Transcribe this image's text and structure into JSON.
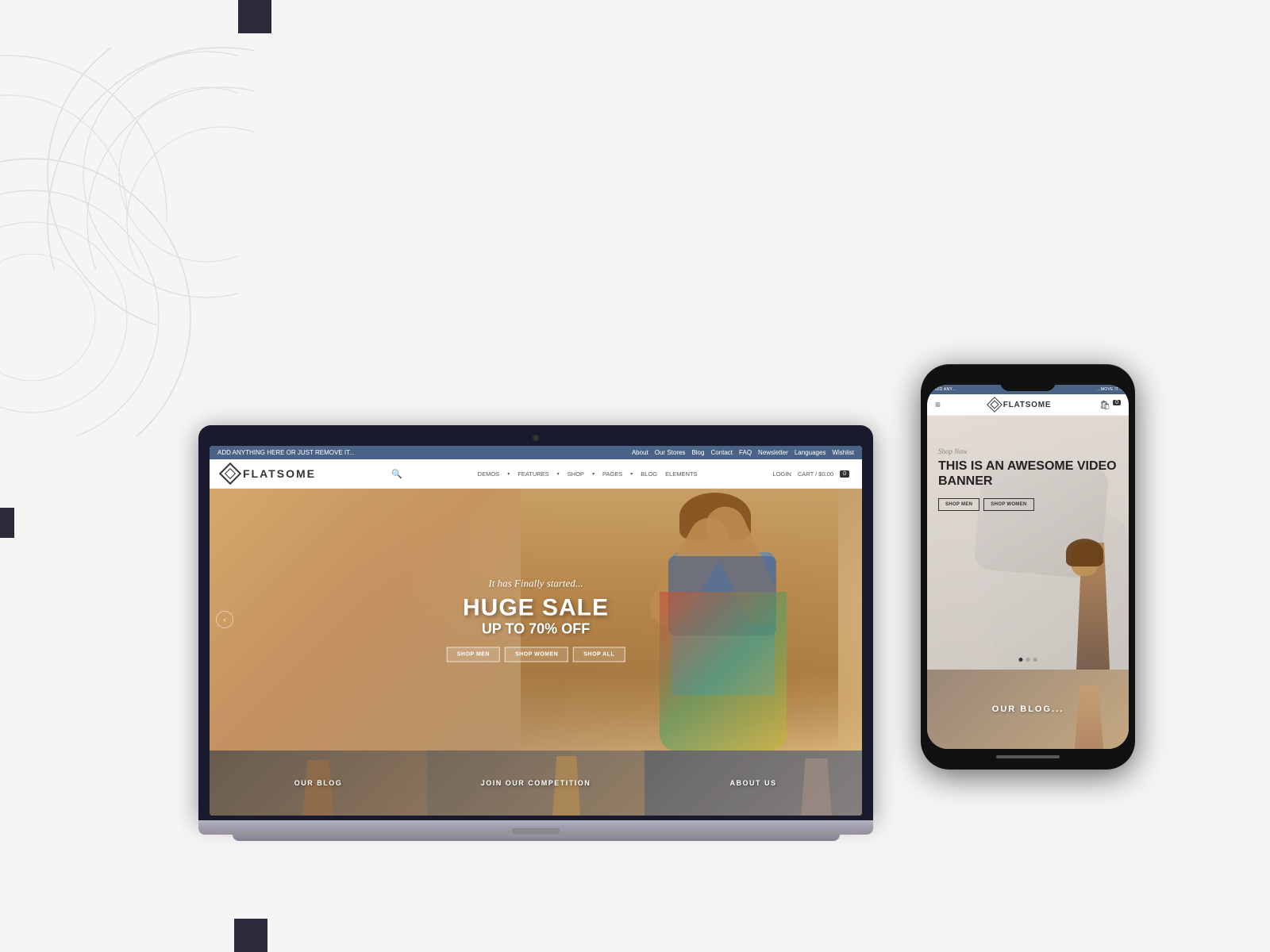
{
  "background": {
    "color": "#f5f5f5"
  },
  "laptop": {
    "website": {
      "topbar": {
        "left_text": "ADD ANYTHING HERE OR JUST REMOVE IT...",
        "nav_items": [
          "About",
          "Our Stores",
          "Blog",
          "Contact",
          "FAQ",
          "Newsletter",
          "Languages",
          "Wishlist"
        ]
      },
      "header": {
        "logo_text": "FLATSOME",
        "nav_items": [
          "DEMOS",
          "FEATURES",
          "SHOP",
          "PAGES",
          "BLOG",
          "ELEMENTS"
        ],
        "login_text": "LOGIN",
        "cart_text": "CART / $0.00",
        "cart_count": "0"
      },
      "hero": {
        "subtitle": "It has Finally started...",
        "title_line1": "HUGE SALE",
        "title_line2": "UP TO 70% OFF",
        "btn1": "SHOP MEN",
        "btn2": "SHOP WOMEN",
        "btn3": "SHOP ALL"
      },
      "cards": [
        {
          "label": "OUR BLOG"
        },
        {
          "label": "JOIN OUR COMPETITION"
        },
        {
          "label": "ABOUT US"
        }
      ]
    }
  },
  "phone": {
    "website": {
      "topbar": {
        "left_text": "ADD ANY...",
        "right_text": "...MOVE IT..."
      },
      "header": {
        "logo_text": "FLATSOME",
        "cart_count": "0"
      },
      "hero": {
        "shop_now": "Shop Now",
        "title": "THIS IS AN AWESOME VIDEO BANNER",
        "btn1": "SHOP MEN",
        "btn2": "SHOP WOMEN"
      },
      "blog": {
        "label": "OUR BLOG..."
      }
    }
  },
  "decorations": {
    "squares": [
      {
        "class": "sq1",
        "size": "42x42",
        "position": "top-center"
      },
      {
        "class": "sq3",
        "size": "20x42",
        "position": "right-middle"
      },
      {
        "class": "sq4",
        "size": "18x38",
        "position": "left-middle"
      },
      {
        "class": "sq5",
        "size": "42x42",
        "position": "bottom-left"
      }
    ]
  }
}
